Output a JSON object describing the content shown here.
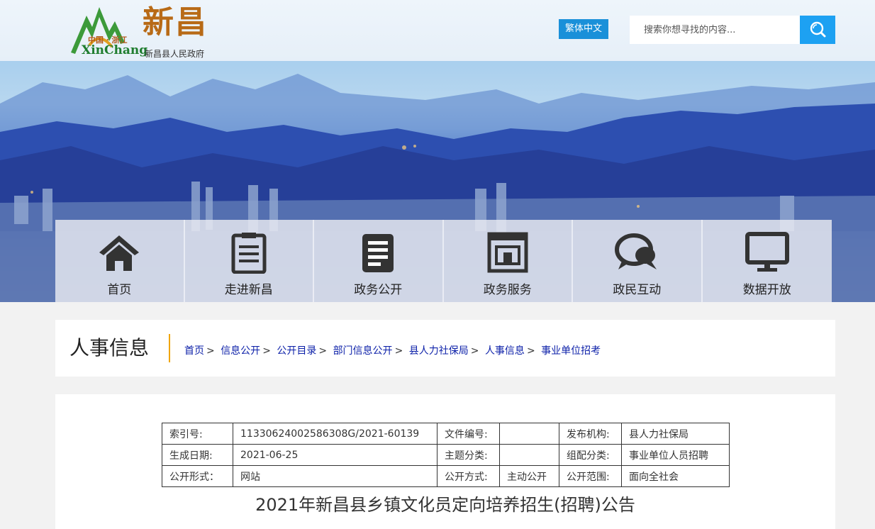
{
  "header": {
    "logo_region": "中国 · 浙江",
    "logo_name": "新昌",
    "logo_en": "XinChang",
    "logo_sub": "新昌县人民政府",
    "lang_button": "繁体中文",
    "search_placeholder": "搜索你想寻找的内容..."
  },
  "nav": {
    "items": [
      {
        "label": "首页",
        "icon": "home-icon"
      },
      {
        "label": "走进新昌",
        "icon": "document-list-icon"
      },
      {
        "label": "政务公开",
        "icon": "news-doc-icon"
      },
      {
        "label": "政务服务",
        "icon": "service-window-icon"
      },
      {
        "label": "政民互动",
        "icon": "chat-bubbles-icon"
      },
      {
        "label": "数据开放",
        "icon": "monitor-icon"
      }
    ]
  },
  "breadcrumb": {
    "title": "人事信息",
    "items": [
      "首页",
      "信息公开",
      "公开目录",
      "部门信息公开",
      "县人力社保局",
      "人事信息",
      "事业单位招考"
    ],
    "separator": ">"
  },
  "meta_table": {
    "row1": {
      "k1": "索引号:",
      "v1": "11330624002586308G/2021-60139",
      "k2": "文件编号:",
      "v2": "",
      "k3": "发布机构:",
      "v3": "县人力社保局"
    },
    "row2": {
      "k1": "生成日期:",
      "v1": "2021-06-25",
      "k2": "主题分类:",
      "v2": "",
      "k3": "组配分类:",
      "v3": "事业单位人员招聘"
    },
    "row3": {
      "k1": "公开形式：",
      "v1": "网站",
      "k2": "公开方式:",
      "v2": "主动公开",
      "k3": "公开范围:",
      "v3": "面向全社会"
    }
  },
  "document": {
    "title": "2021年新昌县乡镇文化员定向培养招生(招聘)公告"
  },
  "colors": {
    "accent_blue": "#1da1f2",
    "lang_blue": "#1a90d9",
    "crumb_link": "#0b1fa8",
    "crumb_bar": "#f0a500"
  }
}
